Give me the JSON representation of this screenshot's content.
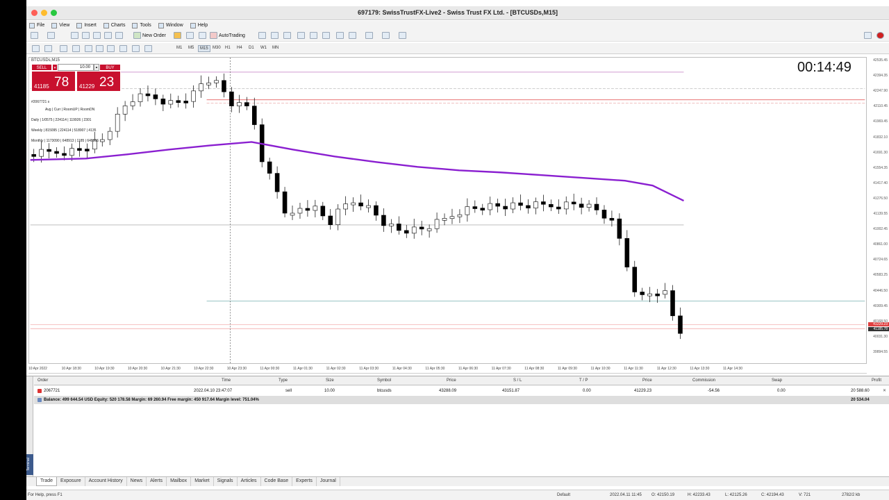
{
  "window": {
    "title": "697179: SwissTrustFX-Live2 - Swiss Trust FX Ltd. - [BTCUSDs,M15]"
  },
  "menu": [
    "File",
    "View",
    "Insert",
    "Charts",
    "Tools",
    "Window",
    "Help"
  ],
  "toolbar": {
    "new_order": "New Order",
    "auto_trading": "AutoTrading",
    "timeframes": [
      "M1",
      "M5",
      "M15",
      "M30",
      "H1",
      "H4",
      "D1",
      "W1",
      "MN"
    ],
    "active_timeframe": "M15"
  },
  "chart": {
    "symbol_label": "BTCUSDs,M15",
    "timer": "00:14:49",
    "one_click": {
      "sell_label": "SELL",
      "buy_label": "BUY",
      "volume": "10.00",
      "sell_price_prefix": "41185",
      "sell_price_big": "78",
      "buy_price_prefix": "41229",
      "buy_price_big": "23"
    },
    "info_lines": [
      "#2067721 s",
      "Avg | Curr | RoomUP | RoomDN",
      "Daily | 1/0575 | 224114 | 119926 | 2301",
      "Weekly | 815095 | 224114 | 518907 | 4135",
      "Monthly | 1173090 | 648913 | 1185 | 648555"
    ],
    "price_labels": [
      "42535.45",
      "42394.35",
      "42247.90",
      "42110.45",
      "41969.45",
      "41832.10",
      "41691.30",
      "41554.35",
      "41417.40",
      "41276.50",
      "41139.55",
      "41002.45",
      "40861.00",
      "40724.65",
      "40583.25",
      "40446.50",
      "40309.45",
      "40168.50",
      "40031.30",
      "39894.55"
    ],
    "ask_tag": "41229.23",
    "bid_tag": "41185.78",
    "time_labels": [
      "10 Apr 2022",
      "10 Apr 18:30",
      "10 Apr 19:30",
      "10 Apr 20:30",
      "10 Apr 21:30",
      "10 Apr 22:30",
      "10 Apr 23:30",
      "11 Apr 00:30",
      "11 Apr 01:30",
      "11 Apr 02:30",
      "11 Apr 03:30",
      "11 Apr 04:30",
      "11 Apr 05:30",
      "11 Apr 06:30",
      "11 Apr 07:30",
      "11 Apr 08:30",
      "11 Apr 09:30",
      "11 Apr 10:30",
      "11 Apr 11:30",
      "11 Apr 12:30",
      "11 Apr 13:30",
      "11 Apr 14:30"
    ],
    "colors": {
      "ma_line": "#8a1fd0",
      "bull_candle": "#ffffff",
      "bear_candle": "#000000",
      "sell_button": "#c8102e",
      "ask_line": "#e04040",
      "bid_line": "#e04040"
    }
  },
  "terminal": {
    "columns": [
      "Order",
      "Time",
      "Type",
      "Size",
      "Symbol",
      "Price",
      "S / L",
      "T / P",
      "Price",
      "Commission",
      "Swap",
      "Profit"
    ],
    "rows": [
      {
        "order": "2067721",
        "time": "2022.04.10 23:47:07",
        "type": "sell",
        "size": "10.00",
        "symbol": "btcusds",
        "price": "43288.09",
        "sl": "43151.87",
        "tp": "0.00",
        "cur_price": "41229.23",
        "commission": "-54.56",
        "swap": "0.00",
        "profit": "20 588.60"
      }
    ],
    "balance_line": "Balance: 499 644.54 USD  Equity: 520 178.58  Margin: 69 260.94  Free margin: 450 917.64  Margin level: 751.04%",
    "balance_profit": "20 534.04",
    "side_label": "Terminal",
    "tabs": [
      "Trade",
      "Exposure",
      "Account History",
      "News",
      "Alerts",
      "Mailbox",
      "Market",
      "Signals",
      "Articles",
      "Code Base",
      "Experts",
      "Journal"
    ],
    "active_tab": "Trade"
  },
  "status": {
    "help": "For Help, press F1",
    "profile": "Default",
    "datetime": "2022.04.11 11:45",
    "open": "O: 42150.19",
    "high": "H: 42233.43",
    "low": "L: 42125.26",
    "close": "C: 42194.43",
    "volume": "V: 721",
    "traffic": "2782/2 kb"
  }
}
